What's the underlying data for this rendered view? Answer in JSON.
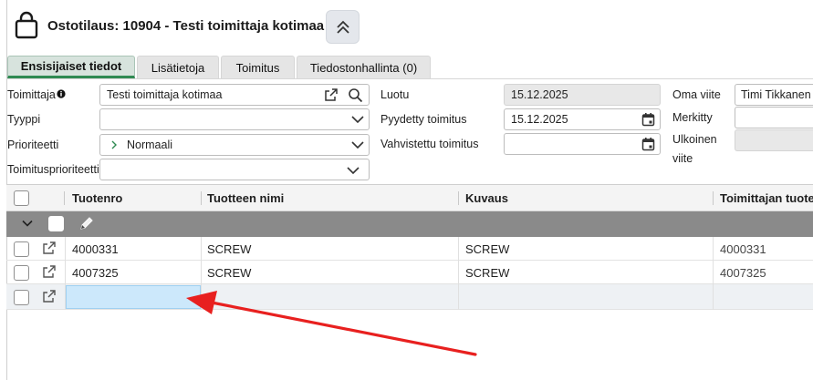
{
  "header": {
    "title": "Ostotilaus: 10904 - Testi toimittaja kotimaa",
    "icon": "shopping-bag-icon",
    "collapse_icon": "chevron-double-up-icon"
  },
  "tabs": [
    {
      "label": "Ensisijaiset tiedot",
      "active": true
    },
    {
      "label": "Lisätietoja",
      "active": false
    },
    {
      "label": "Toimitus",
      "active": false
    },
    {
      "label": "Tiedostonhallinta (0)",
      "active": false
    }
  ],
  "form": {
    "supplier": {
      "label": "Toimittaja",
      "value": "Testi toimittaja kotimaa"
    },
    "type": {
      "label": "Tyyppi",
      "value": ""
    },
    "priority": {
      "label": "Prioriteetti",
      "value": "Normaali"
    },
    "delivery_priority": {
      "label": "Toimitusprioriteetti",
      "value": ""
    },
    "created": {
      "label": "Luotu",
      "value": "15.12.2025"
    },
    "requested_delivery": {
      "label": "Pyydetty toimitus",
      "value": "15.12.2025"
    },
    "confirmed_delivery": {
      "label": "Vahvistettu toimitus",
      "value": ""
    },
    "own_reference": {
      "label": "Oma viite",
      "value": "Timi Tikkanen"
    },
    "marked": {
      "label": "Merkitty",
      "value": ""
    },
    "external_reference": {
      "label_line1": "Ulkoinen",
      "label_line2": "viite",
      "value": ""
    }
  },
  "grid": {
    "columns": [
      "Tuotenro",
      "Tuotteen nimi",
      "Kuvaus",
      "Toimittajan tuote"
    ],
    "rows": [
      {
        "product_no": "4000331",
        "name": "SCREW",
        "description": "SCREW",
        "supplier_product": "4000331"
      },
      {
        "product_no": "4007325",
        "name": "SCREW",
        "description": "SCREW",
        "supplier_product": "4007325"
      },
      {
        "product_no": "",
        "name": "",
        "description": "",
        "supplier_product": ""
      }
    ]
  },
  "colors": {
    "active_tab_underline": "#2f8a52",
    "active_tab_bg": "#d7e3dd",
    "group_row_bg": "#8a8a8a",
    "selected_cell_bg": "#cce8fb",
    "annotation_arrow": "#e8201f"
  }
}
